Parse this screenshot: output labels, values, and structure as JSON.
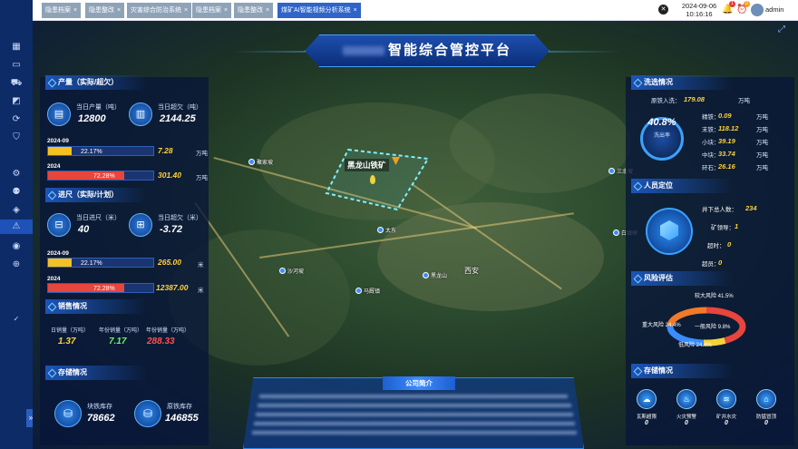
{
  "sidebar": {
    "logo_text": "",
    "items": [
      {
        "icon": "grid-icon"
      },
      {
        "icon": "monitor-icon"
      },
      {
        "icon": "truck-icon"
      },
      {
        "icon": "chart-icon"
      },
      {
        "icon": "link-icon"
      },
      {
        "icon": "shield-icon"
      },
      {
        "icon": "gear-icon"
      },
      {
        "icon": "user-icon"
      },
      {
        "icon": "layers-icon"
      },
      {
        "icon": "warning-icon"
      },
      {
        "icon": "video-icon"
      },
      {
        "icon": "globe-icon"
      }
    ],
    "collapse_glyph": "»"
  },
  "topbar": {
    "tabs": [
      {
        "label": "隐患档案",
        "active": false
      },
      {
        "label": "隐患整改",
        "active": false
      },
      {
        "label": "灾害综合防治系统",
        "active": false
      },
      {
        "label": "隐患档案",
        "active": false
      },
      {
        "label": "隐患整改",
        "active": false
      },
      {
        "label": "煤矿AI智能视频分析系统",
        "active": true
      }
    ],
    "tab_close_glyph": "×",
    "date": "2024-09-06",
    "time": "10:16:16",
    "bell_badge": "1",
    "alarm_badge": "0",
    "username": "admin"
  },
  "header": {
    "title": "智能综合管控平台"
  },
  "production": {
    "title": "产量（实际/超欠）",
    "daily_output_label": "当日产量（吨）",
    "daily_output_value": "12800",
    "daily_deficit_label": "当日超欠（吨）",
    "daily_deficit_value": "2144.25",
    "month_label": "2024-09",
    "month_pct": "22.17%",
    "month_pct_value": 22.17,
    "month_value": "7.28",
    "month_unit": "万吨",
    "year_label": "2024",
    "year_pct": "72.28%",
    "year_pct_value": 72.28,
    "year_value": "301.40",
    "year_unit": "万吨"
  },
  "advance": {
    "title": "进尺（实际/计划）",
    "daily_label": "当日进尺（米）",
    "daily_value": "40",
    "deficit_label": "当日超欠（米）",
    "deficit_value": "-3.72",
    "month_label": "2024-09",
    "month_pct": "22.17%",
    "month_pct_value": 22.17,
    "month_value": "265.00",
    "month_unit": "米",
    "year_label": "2024",
    "year_pct": "72.28%",
    "year_pct_value": 72.28,
    "year_value": "12387.00",
    "year_unit": "米"
  },
  "sales": {
    "title": "销售情况",
    "daily_label": "日销量（万吨）",
    "daily_value": "1.37",
    "monthly_label": "年份销量（万吨）",
    "monthly_value": "7.17",
    "yearly_label": "年份销量（万吨）",
    "yearly_value": "288.33"
  },
  "storage_left": {
    "title": "存储情况",
    "block_label": "块铁库存",
    "block_value": "78662",
    "raw_label": "原铁库存",
    "raw_value": "146855"
  },
  "company": {
    "title": "公司简介"
  },
  "map": {
    "mine_name": "黑龙山铁矿",
    "places": [
      "聚家坡",
      "白银峡",
      "太东",
      "沙河坡",
      "马厩镇",
      "黑龙山",
      "西安",
      "三北坡"
    ]
  },
  "washing": {
    "title": "洗选情况",
    "raw_in_label": "原铁入洗：",
    "raw_in_value": "179.08",
    "raw_in_unit": "万吨",
    "rate_value": "40.8%",
    "rate_label": "洗出率",
    "items": [
      {
        "label": "精铁：",
        "value": "0.09",
        "unit": "万吨"
      },
      {
        "label": "末铁：",
        "value": "118.12",
        "unit": "万吨"
      },
      {
        "label": "小块：",
        "value": "39.19",
        "unit": "万吨"
      },
      {
        "label": "中块：",
        "value": "33.74",
        "unit": "万吨"
      },
      {
        "label": "矸石：",
        "value": "26.16",
        "unit": "万吨"
      }
    ]
  },
  "personnel": {
    "title": "人员定位",
    "total_label": "井下总人数：",
    "total_value": "234",
    "leader_label": "矿领导：",
    "leader_value": "1",
    "overtime_label": "超时：",
    "overtime_value": "0",
    "overcrew_label": "超员：",
    "overcrew_value": "0"
  },
  "risk": {
    "title": "风险评估",
    "major_label": "较大风险 41.5%",
    "major_pct": 41.5,
    "major_color": "#e8453c",
    "critical_label": "重大风险 24.4%",
    "critical_pct": 24.4,
    "critical_color": "#f07a2a",
    "normal_label": "一般风险 9.8%",
    "normal_pct": 9.8,
    "normal_color": "#f3d33a",
    "low_label": "低风险 24.4%",
    "low_pct": 24.4,
    "low_color": "#3a8cff"
  },
  "storage_right": {
    "title": "存储情况",
    "items": [
      {
        "label": "瓦斯超限",
        "value": "0",
        "icon": "gas-icon"
      },
      {
        "label": "火灾预警",
        "value": "0",
        "icon": "fire-icon"
      },
      {
        "label": "矿井水灾",
        "value": "0",
        "icon": "water-icon"
      },
      {
        "label": "防猛冒顶",
        "value": "0",
        "icon": "roof-icon"
      }
    ]
  }
}
